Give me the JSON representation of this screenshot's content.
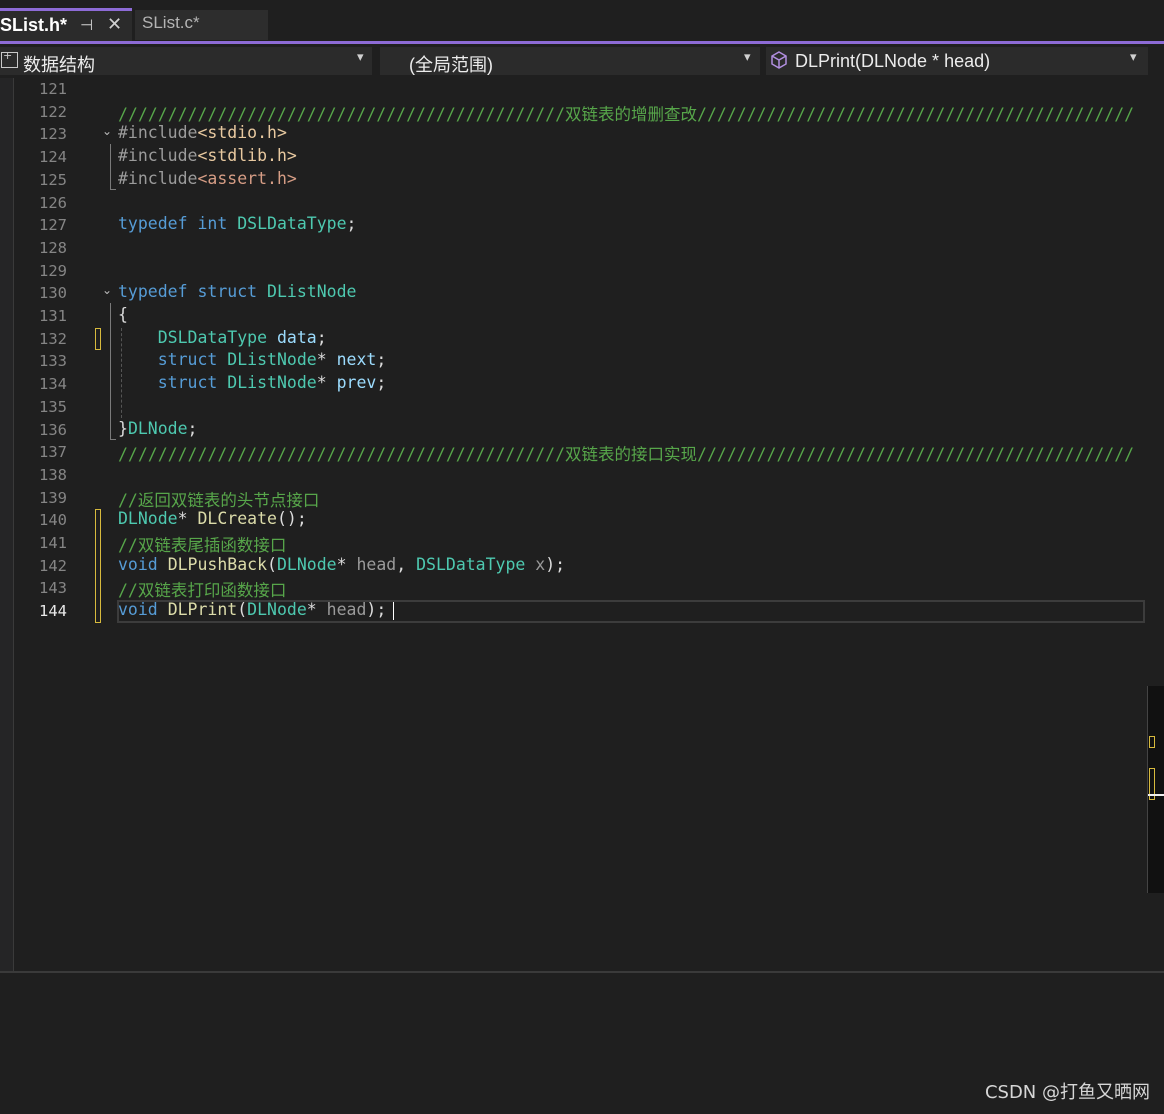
{
  "tabs": {
    "active": {
      "name": "SList.h*",
      "pin_glyph": "⊣",
      "close_glyph": "✕"
    },
    "inactive": {
      "name": "SList.c*"
    }
  },
  "navbar": {
    "project": "数据结构",
    "scope": "(全局范围)",
    "member": "DLPrint(DLNode * head)",
    "dropdown_glyph": "▾"
  },
  "editor": {
    "fold_glyph": "⌄",
    "line_numbers": [
      "121",
      "122",
      "123",
      "124",
      "125",
      "126",
      "127",
      "128",
      "129",
      "130",
      "131",
      "132",
      "133",
      "134",
      "135",
      "136",
      "137",
      "138",
      "139",
      "140",
      "141",
      "142",
      "143",
      "144"
    ],
    "current_line": "144",
    "lines": [
      [],
      [
        {
          "c": "t-com",
          "t": "/////////////////////////////////////////////双链表的增删查改////////////////////////////////////////////"
        }
      ],
      [
        {
          "c": "t-pp",
          "t": "#include"
        },
        {
          "c": "t-str",
          "t": "<stdio.h>"
        }
      ],
      [
        {
          "c": "t-pp",
          "t": "#include"
        },
        {
          "c": "t-str",
          "t": "<stdlib.h>"
        }
      ],
      [
        {
          "c": "t-pp",
          "t": "#include"
        },
        {
          "c": "t-str2",
          "t": "<assert.h>"
        }
      ],
      [],
      [
        {
          "c": "t-kw",
          "t": "typedef"
        },
        {
          "c": "t-def",
          "t": " "
        },
        {
          "c": "t-kw",
          "t": "int"
        },
        {
          "c": "t-def",
          "t": " "
        },
        {
          "c": "t-type",
          "t": "DSLDataType"
        },
        {
          "c": "t-def",
          "t": ";"
        }
      ],
      [],
      [],
      [
        {
          "c": "t-kw",
          "t": "typedef"
        },
        {
          "c": "t-def",
          "t": " "
        },
        {
          "c": "t-kw",
          "t": "struct"
        },
        {
          "c": "t-def",
          "t": " "
        },
        {
          "c": "t-type",
          "t": "DListNode"
        }
      ],
      [
        {
          "c": "t-def",
          "t": "{"
        }
      ],
      [
        {
          "c": "t-def",
          "t": "    "
        },
        {
          "c": "t-type",
          "t": "DSLDataType"
        },
        {
          "c": "t-def",
          "t": " "
        },
        {
          "c": "t-var",
          "t": "data"
        },
        {
          "c": "t-def",
          "t": ";"
        }
      ],
      [
        {
          "c": "t-def",
          "t": "    "
        },
        {
          "c": "t-kw",
          "t": "struct"
        },
        {
          "c": "t-def",
          "t": " "
        },
        {
          "c": "t-type",
          "t": "DListNode"
        },
        {
          "c": "t-def",
          "t": "* "
        },
        {
          "c": "t-var",
          "t": "next"
        },
        {
          "c": "t-def",
          "t": ";"
        }
      ],
      [
        {
          "c": "t-def",
          "t": "    "
        },
        {
          "c": "t-kw",
          "t": "struct"
        },
        {
          "c": "t-def",
          "t": " "
        },
        {
          "c": "t-type",
          "t": "DListNode"
        },
        {
          "c": "t-def",
          "t": "* "
        },
        {
          "c": "t-var",
          "t": "prev"
        },
        {
          "c": "t-def",
          "t": ";"
        }
      ],
      [],
      [
        {
          "c": "t-def",
          "t": "}"
        },
        {
          "c": "t-type",
          "t": "DLNode"
        },
        {
          "c": "t-def",
          "t": ";"
        }
      ],
      [
        {
          "c": "t-com",
          "t": "/////////////////////////////////////////////双链表的接口实现////////////////////////////////////////////"
        }
      ],
      [],
      [
        {
          "c": "t-com",
          "t": "//返回双链表的头节点接口"
        }
      ],
      [
        {
          "c": "t-type",
          "t": "DLNode"
        },
        {
          "c": "t-def",
          "t": "* "
        },
        {
          "c": "t-fn",
          "t": "DLCreate"
        },
        {
          "c": "t-def",
          "t": "();"
        }
      ],
      [
        {
          "c": "t-com",
          "t": "//双链表尾插函数接口"
        }
      ],
      [
        {
          "c": "t-kw",
          "t": "void"
        },
        {
          "c": "t-def",
          "t": " "
        },
        {
          "c": "t-fn",
          "t": "DLPushBack"
        },
        {
          "c": "t-def",
          "t": "("
        },
        {
          "c": "t-type",
          "t": "DLNode"
        },
        {
          "c": "t-def",
          "t": "* "
        },
        {
          "c": "t-param",
          "t": "head"
        },
        {
          "c": "t-def",
          "t": ", "
        },
        {
          "c": "t-type",
          "t": "DSLDataType"
        },
        {
          "c": "t-def",
          "t": " "
        },
        {
          "c": "t-param",
          "t": "x"
        },
        {
          "c": "t-def",
          "t": ");"
        }
      ],
      [
        {
          "c": "t-com",
          "t": "//双链表打印函数接口"
        }
      ],
      [
        {
          "c": "t-kw",
          "t": "void"
        },
        {
          "c": "t-def",
          "t": " "
        },
        {
          "c": "t-fn",
          "t": "DLPrint"
        },
        {
          "c": "t-def",
          "t": "("
        },
        {
          "c": "t-type",
          "t": "DLNode"
        },
        {
          "c": "t-def",
          "t": "* "
        },
        {
          "c": "t-param",
          "t": "head"
        },
        {
          "c": "t-def",
          "t": ");"
        }
      ]
    ]
  },
  "colors": {
    "accent": "#8d6bd6",
    "change_marker": "#d7ba3d",
    "comment": "#57a64a",
    "keyword": "#569cd6",
    "type": "#4ec9b0",
    "function": "#dcdcaa"
  },
  "watermark": "CSDN @打鱼又晒网"
}
